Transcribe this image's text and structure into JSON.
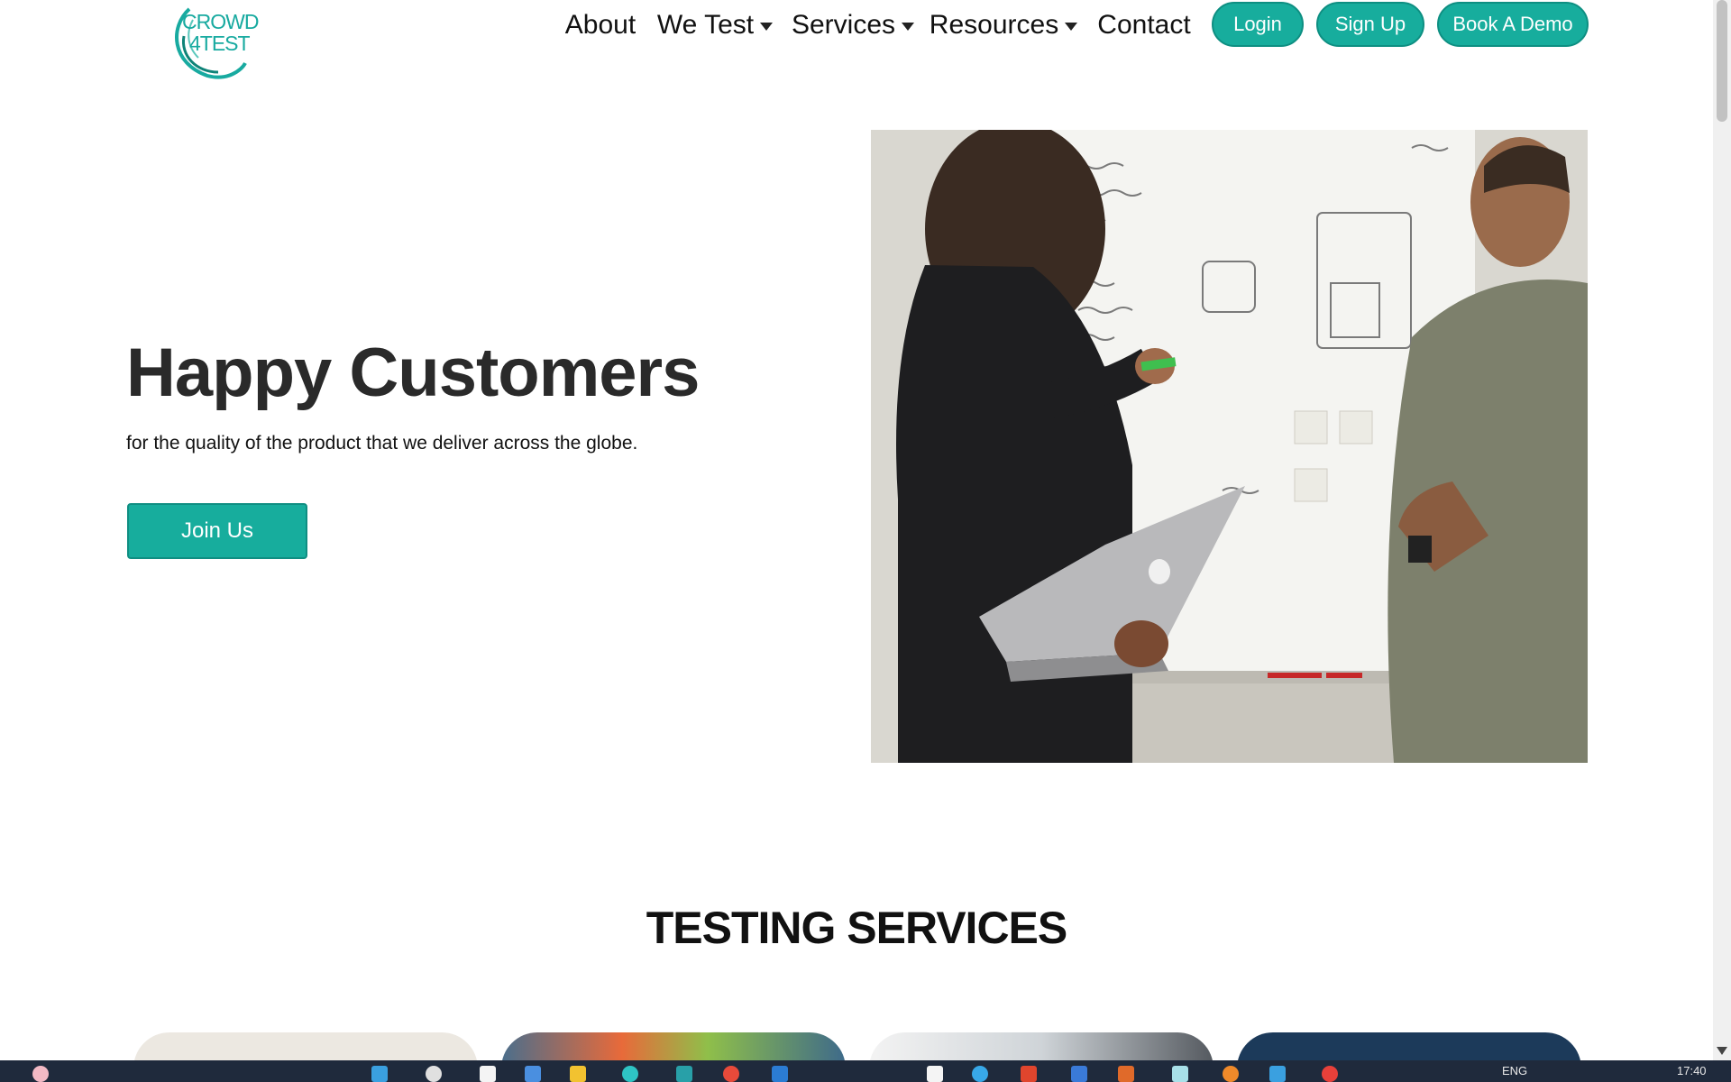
{
  "header": {
    "logo": {
      "line1": "CROWD",
      "line2": "4TEST"
    },
    "nav": [
      {
        "label": "About",
        "dropdown": false
      },
      {
        "label": "We Test",
        "dropdown": true
      },
      {
        "label": "Services",
        "dropdown": true
      },
      {
        "label": "Resources",
        "dropdown": true
      },
      {
        "label": "Contact",
        "dropdown": false
      }
    ],
    "buttons": {
      "login": "Login",
      "signup": "Sign Up",
      "demo": "Book A Demo"
    }
  },
  "hero": {
    "title": "Happy Customers",
    "subtitle": "for the quality of the product that we deliver across the globe.",
    "cta": "Join Us",
    "image": "people-at-whiteboard-photo"
  },
  "section": {
    "title": "TESTING SERVICES"
  },
  "taskbar": {
    "lang": "ENG",
    "time": "17:40"
  },
  "colors": {
    "accent": "#17ad9d",
    "text": "#111111",
    "taskbar": "#1f2a3c"
  }
}
